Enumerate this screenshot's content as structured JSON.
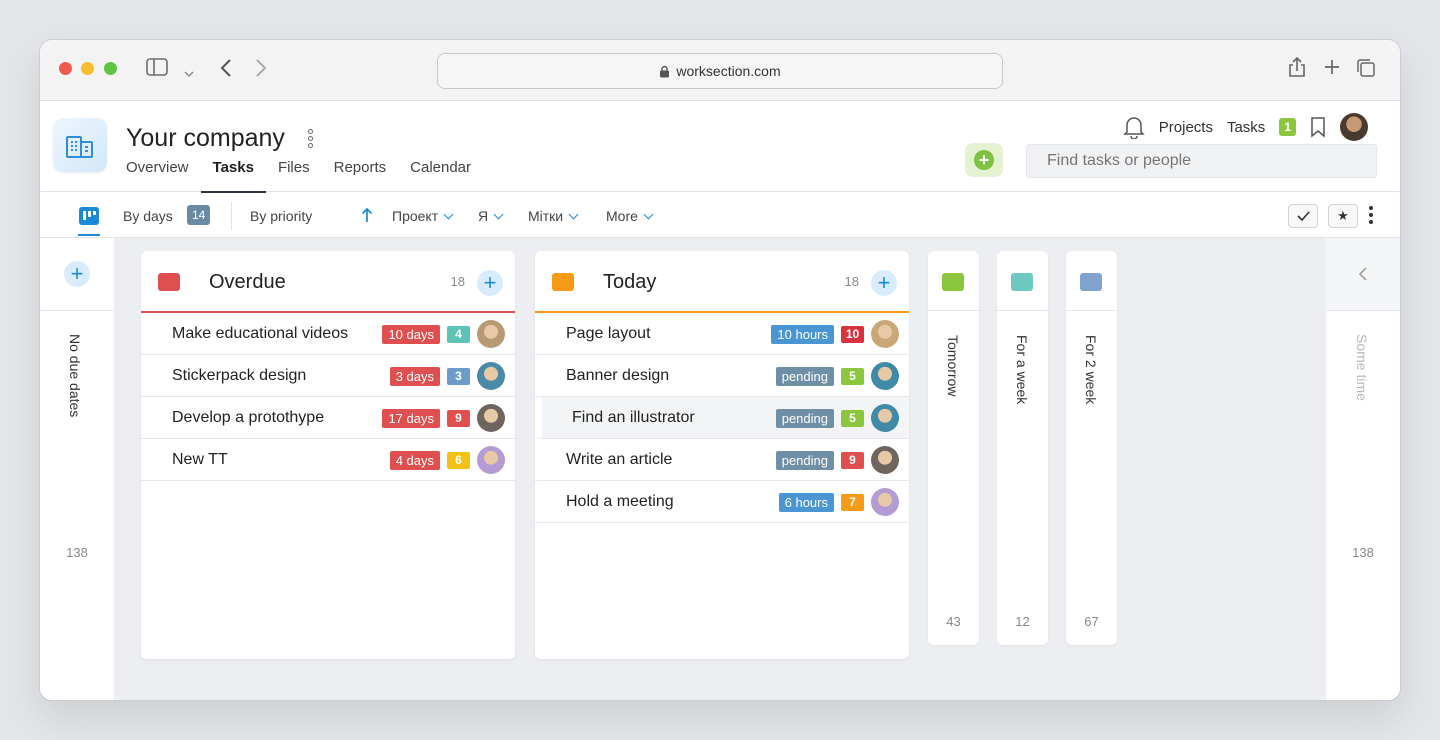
{
  "browser": {
    "url": "worksection.com"
  },
  "header": {
    "company": "Your company",
    "tabs": [
      {
        "label": "Overview",
        "active": false
      },
      {
        "label": "Tasks",
        "active": true
      },
      {
        "label": "Files",
        "active": false
      },
      {
        "label": "Reports",
        "active": false
      },
      {
        "label": "Calendar",
        "active": false
      }
    ],
    "nav_projects": "Projects",
    "nav_tasks": "Tasks",
    "tasks_badge": "1",
    "search_placeholder": "Find tasks or people"
  },
  "toolbar": {
    "by_days": "By days",
    "by_days_count": "14",
    "by_priority": "By priority",
    "filter_project": "Проект",
    "filter_me": "Я",
    "filter_tags": "Мітки",
    "more": "More"
  },
  "board": {
    "no_due": {
      "label": "No due dates",
      "count": "138"
    },
    "some_time": {
      "label": "Some time",
      "count": "138"
    },
    "overdue": {
      "title": "Overdue",
      "count": "18",
      "color": "#e04f4f",
      "tasks": [
        {
          "name": "Make educational videos",
          "label": "10 days",
          "label_color": "#e04f4f",
          "priority": "4",
          "priority_color": "#5dc3b9",
          "avatar": "#b79a74"
        },
        {
          "name": "Stickerpack design",
          "label": "3 days",
          "label_color": "#e04f4f",
          "priority": "3",
          "priority_color": "#6c9bc9",
          "avatar": "#4a8aa8"
        },
        {
          "name": "Develop a protothype",
          "label": "17 days",
          "label_color": "#e04f4f",
          "priority": "9",
          "priority_color": "#e04f4f",
          "avatar": "#6e655e"
        },
        {
          "name": "New TT",
          "label": "4 days",
          "label_color": "#e04f4f",
          "priority": "6",
          "priority_color": "#f5c016",
          "avatar": "#b39bd4"
        }
      ]
    },
    "today": {
      "title": "Today",
      "count": "18",
      "color": "#f59b17",
      "tasks": [
        {
          "name": "Page layout",
          "label": "10 hours",
          "label_color": "#4a95d4",
          "priority": "10",
          "priority_color": "#d8323c",
          "avatar": "#c9a877"
        },
        {
          "name": "Banner design",
          "label": "pending",
          "label_color": "#6f8fa7",
          "priority": "5",
          "priority_color": "#8cc63f",
          "avatar": "#3f8aa6"
        },
        {
          "name": "Find an illustrator",
          "label": "pending",
          "label_color": "#6f8fa7",
          "priority": "5",
          "priority_color": "#8cc63f",
          "avatar": "#3f8aa6",
          "highlight": true
        },
        {
          "name": "Write an article",
          "label": "pending",
          "label_color": "#6f8fa7",
          "priority": "9",
          "priority_color": "#e04f4f",
          "avatar": "#6e655e"
        },
        {
          "name": "Hold a meeting",
          "label": "6 hours",
          "label_color": "#4a95d4",
          "priority": "7",
          "priority_color": "#f59b17",
          "avatar": "#b39bd4"
        }
      ]
    },
    "tomorrow": {
      "label": "Tomorrow",
      "count": "43",
      "color": "#8cc63f"
    },
    "week": {
      "label": "For a week",
      "count": "12",
      "color": "#6ec8c0"
    },
    "two_weeks": {
      "label": "For 2 week",
      "count": "67",
      "color": "#7fa3cd"
    }
  }
}
